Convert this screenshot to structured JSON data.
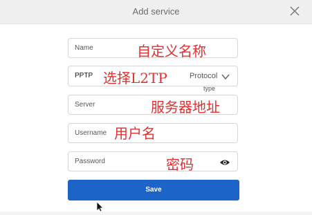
{
  "dialog": {
    "title": "Add service"
  },
  "fields": {
    "name": {
      "placeholder": "Name",
      "annotation": "自定义名称"
    },
    "protocol": {
      "value": "PPTP",
      "annotation": "选择L2TP",
      "label": "Protocol",
      "hint": "type"
    },
    "server": {
      "placeholder": "Server",
      "annotation": "服务器地址"
    },
    "username": {
      "placeholder": "Username",
      "annotation": "用户名"
    },
    "password": {
      "placeholder": "Password",
      "annotation": "密码"
    }
  },
  "buttons": {
    "save": "Save"
  },
  "icons": {
    "close": "close-icon",
    "chevron": "chevron-down-icon",
    "eye": "eye-icon",
    "cursor": "mouse-pointer-icon"
  },
  "colors": {
    "accent": "#1d64c8",
    "annotation": "#e03030"
  }
}
